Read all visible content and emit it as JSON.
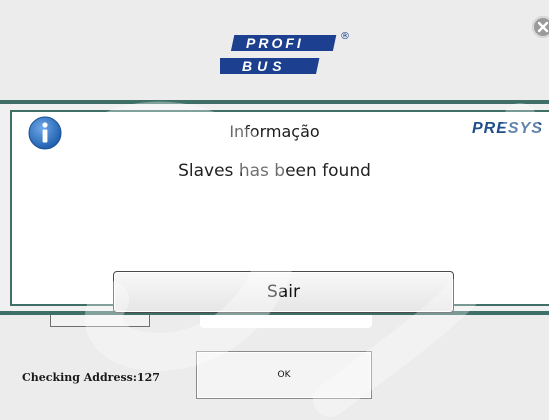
{
  "background_window": {
    "logo": {
      "top_text": "PROFI",
      "bottom_text": "BUS",
      "mark": "®"
    },
    "status_label": "Checking Address:127",
    "ok_button_label": "OK"
  },
  "dialog": {
    "title": "Informação",
    "message": "Slaves has been found",
    "brand": "PRESYS",
    "exit_button_label": "Sair",
    "icon": "info-icon"
  },
  "colors": {
    "dialog_border": "#3f6f66",
    "info_icon": "#2a6fc0",
    "profibus_blue": "#1c3f8f",
    "brand_blue": "#1e4f8c"
  }
}
